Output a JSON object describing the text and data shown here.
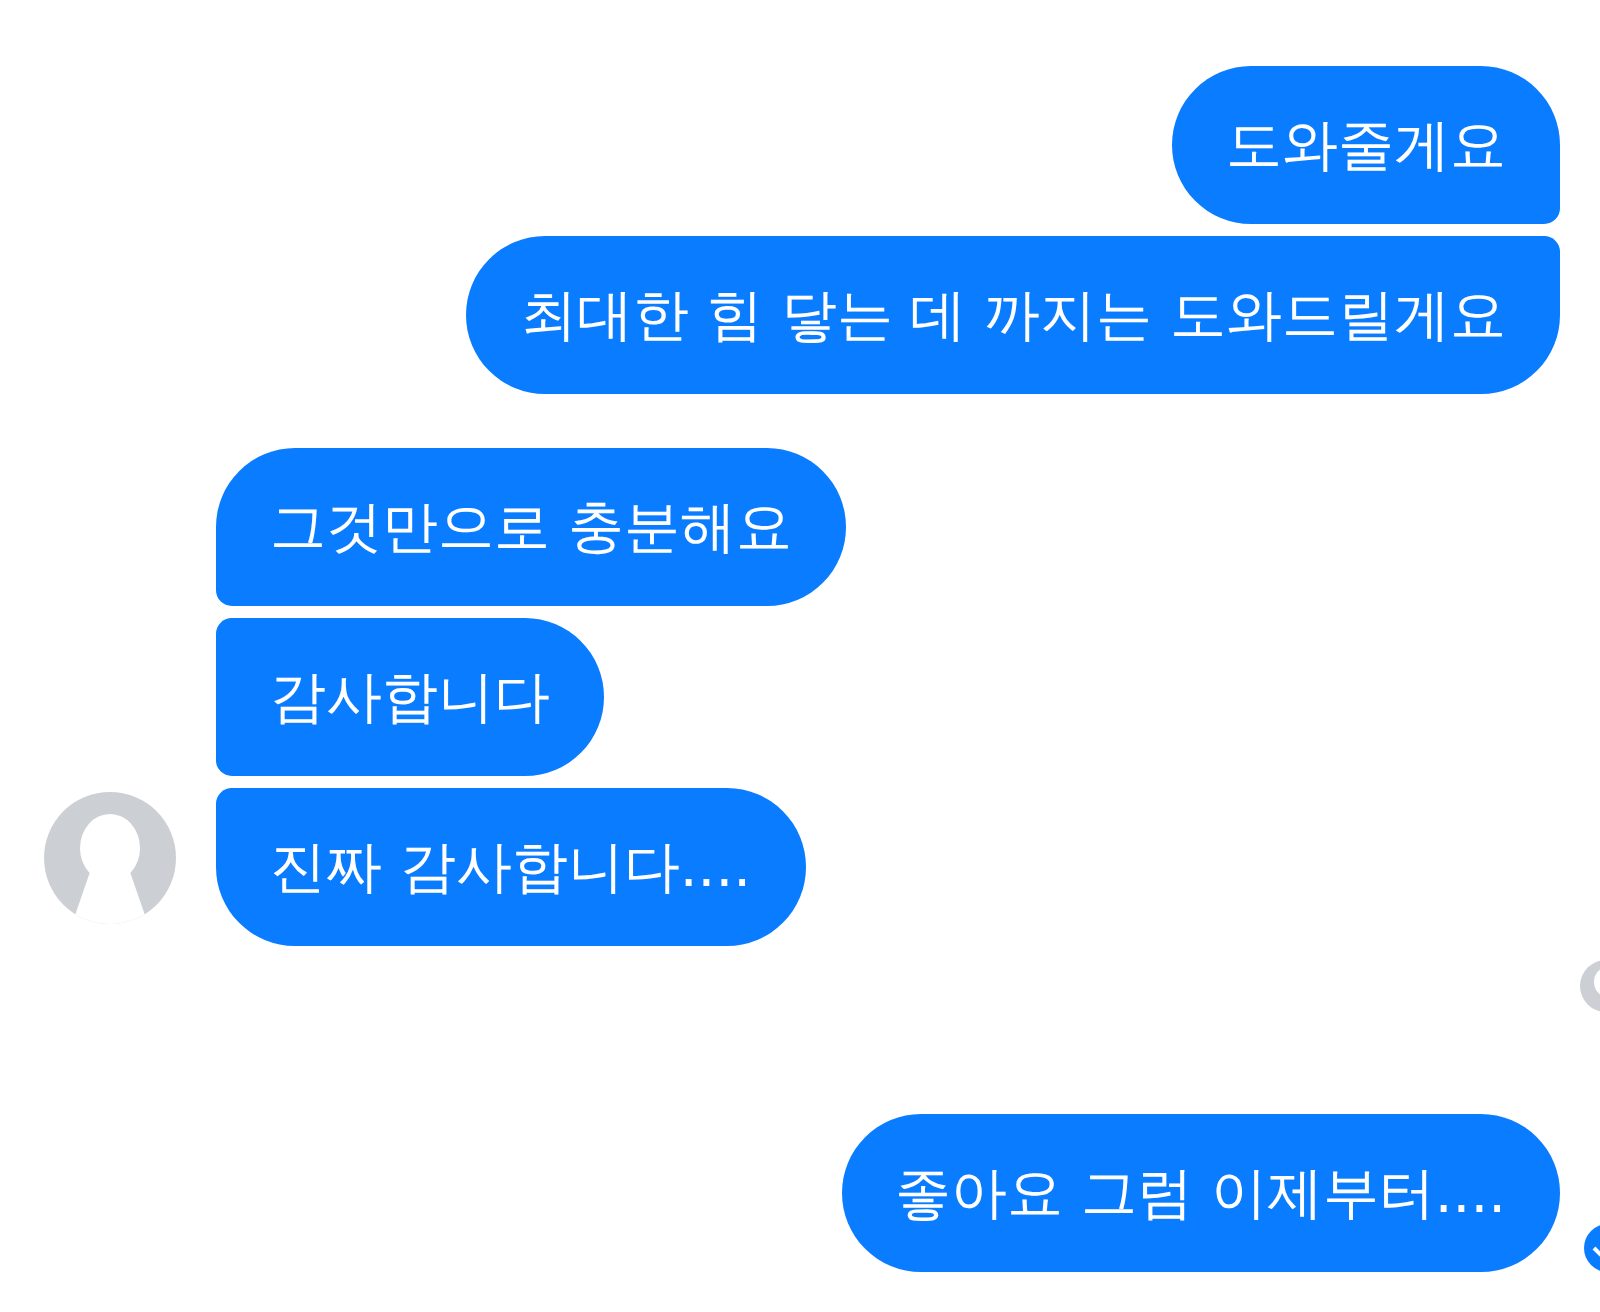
{
  "conversation": [
    {
      "kind": "outgoing",
      "messages": [
        {
          "text": "도와줄게요",
          "sent": false
        },
        {
          "text": "최대한 힘 닿는 데 까지는 도와드릴게요",
          "sent": false
        }
      ]
    },
    {
      "kind": "incoming",
      "messages": [
        {
          "text": "그것만으로 충분해요"
        },
        {
          "text": "감사합니다"
        },
        {
          "text": "진짜 감사합니다...."
        }
      ]
    },
    {
      "kind": "seen_marker"
    },
    {
      "kind": "outgoing",
      "messages": [
        {
          "text": "좋아요 그럼 이제부터....",
          "sent": true
        }
      ]
    }
  ]
}
